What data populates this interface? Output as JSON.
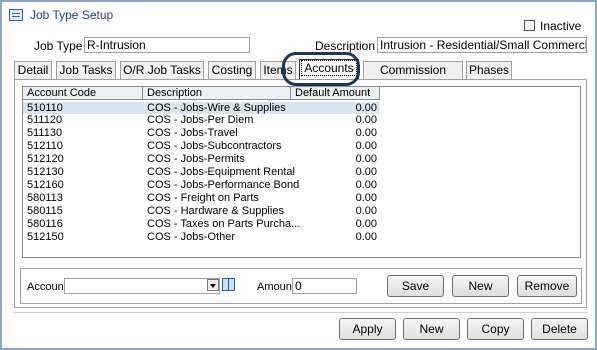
{
  "window": {
    "title": "Job Type Setup",
    "inactive_label": "Inactive"
  },
  "form": {
    "job_type_label": "Job Type",
    "job_type_value": "R-Intrusion",
    "description_label": "Description",
    "description_value": "Intrusion - Residential/Small Commercial"
  },
  "tabs": [
    {
      "label": "Detail"
    },
    {
      "label": "Job Tasks"
    },
    {
      "label": "O/R Job Tasks"
    },
    {
      "label": "Costing"
    },
    {
      "label": "Items"
    },
    {
      "label": "Accounts"
    },
    {
      "label": "Commission Types"
    },
    {
      "label": "Phases"
    }
  ],
  "grid": {
    "headers": [
      "Account Code",
      "Description",
      "Default Amount"
    ],
    "rows": [
      [
        "510110",
        "COS - Jobs-Wire & Supplies",
        "0.00"
      ],
      [
        "511120",
        "COS - Jobs-Per Diem",
        "0.00"
      ],
      [
        "511130",
        "COS - Jobs-Travel",
        "0.00"
      ],
      [
        "512110",
        "COS - Jobs-Subcontractors",
        "0.00"
      ],
      [
        "512120",
        "COS - Jobs-Permits",
        "0.00"
      ],
      [
        "512130",
        "COS - Jobs-Equipment Rental",
        "0.00"
      ],
      [
        "512160",
        "COS - Jobs-Performance Bond",
        "0.00"
      ],
      [
        "580113",
        "COS - Freight on Parts",
        "0.00"
      ],
      [
        "580115",
        "COS - Hardware & Supplies",
        "0.00"
      ],
      [
        "580116",
        "COS - Taxes on Parts Purcha...",
        "0.00"
      ],
      [
        "512150",
        "COS - Jobs-Other",
        "0.00"
      ]
    ]
  },
  "editor": {
    "account_label": "Account",
    "account_value": "",
    "amount_label": "Amount",
    "amount_value": "0",
    "save_label": "Save",
    "new_label": "New",
    "remove_label": "Remove"
  },
  "footer": {
    "apply_label": "Apply",
    "new_label": "New",
    "copy_label": "Copy",
    "delete_label": "Delete"
  }
}
